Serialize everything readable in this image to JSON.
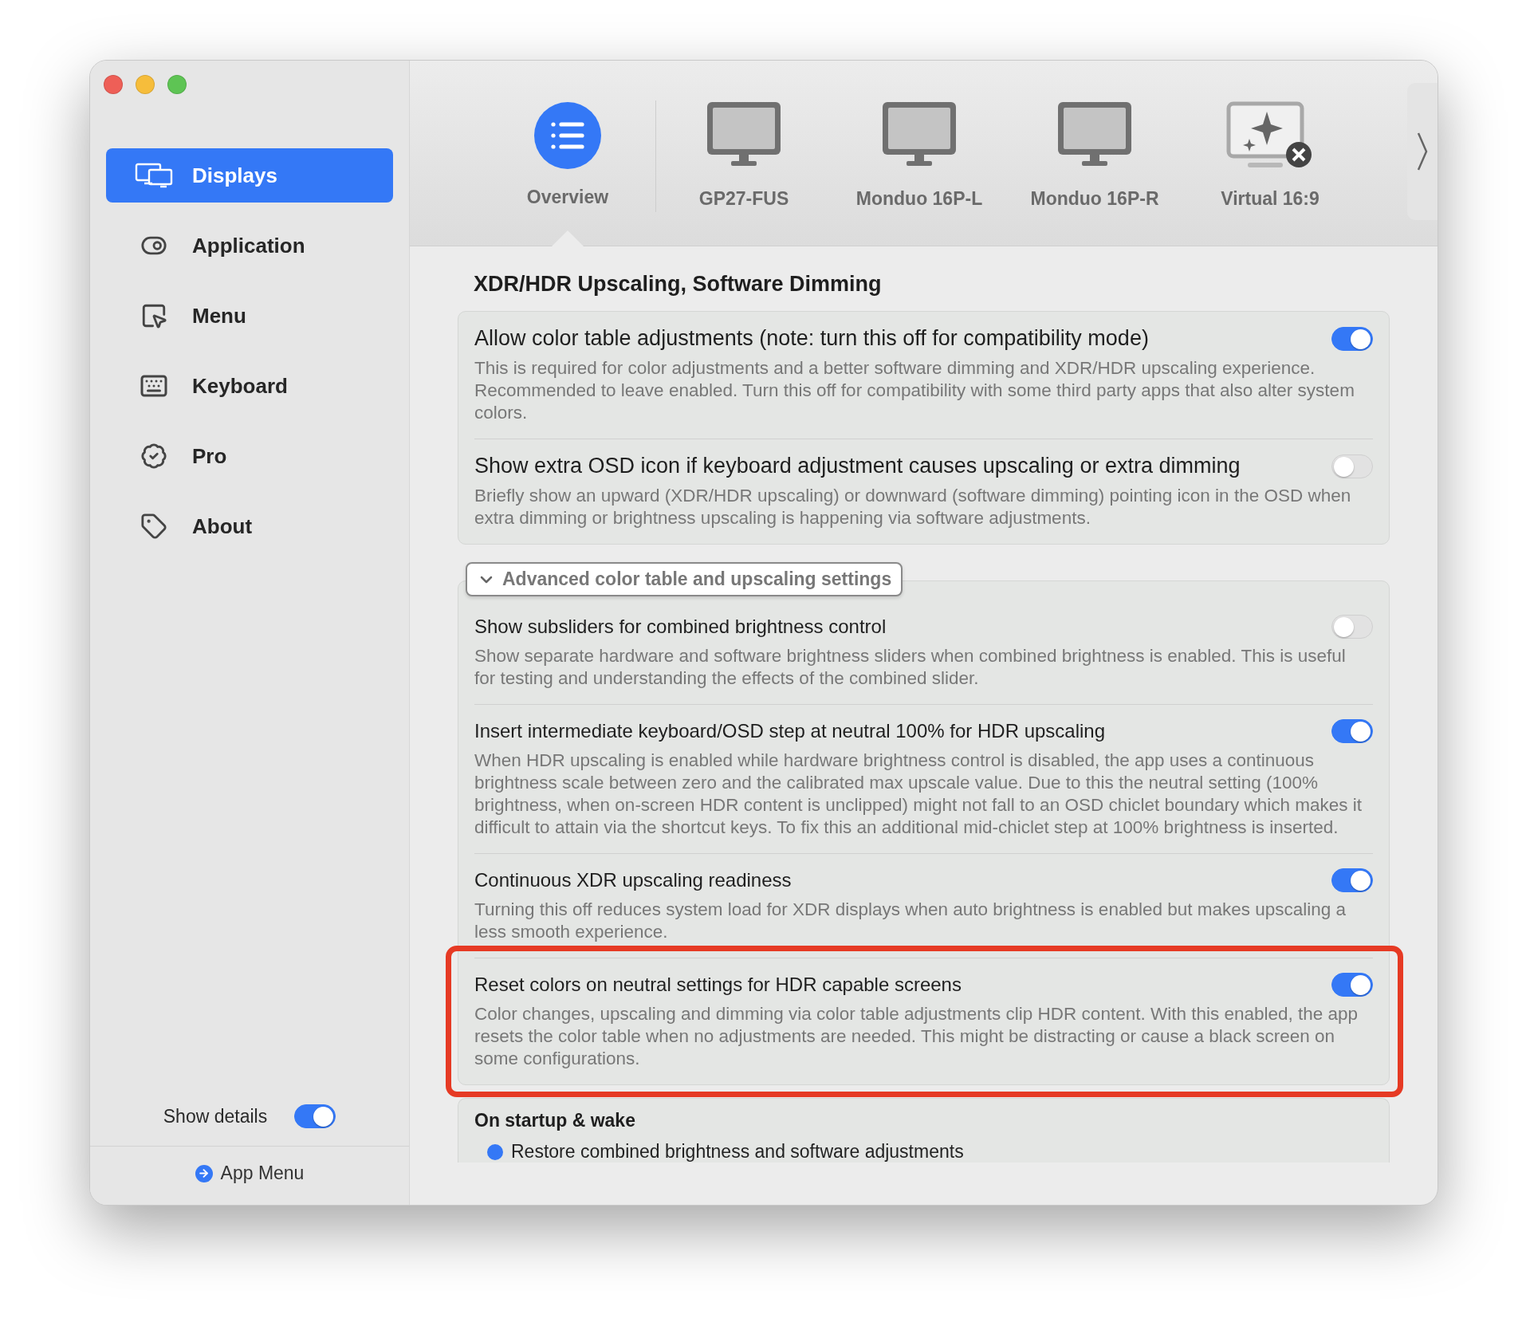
{
  "sidebar": {
    "items": [
      {
        "label": "Displays",
        "kind": "displays",
        "selected": true
      },
      {
        "label": "Application",
        "kind": "application",
        "selected": false
      },
      {
        "label": "Menu",
        "kind": "menu",
        "selected": false
      },
      {
        "label": "Keyboard",
        "kind": "keyboard",
        "selected": false
      },
      {
        "label": "Pro",
        "kind": "pro",
        "selected": false
      },
      {
        "label": "About",
        "kind": "about",
        "selected": false
      }
    ],
    "show_details": {
      "label": "Show details",
      "on": true
    },
    "footer_link": "App Menu"
  },
  "tabs": [
    {
      "label": "Overview",
      "kind": "overview",
      "selected": true
    },
    {
      "label": "GP27-FUS",
      "kind": "display",
      "selected": false
    },
    {
      "label": "Monduo 16P-L",
      "kind": "display",
      "selected": false
    },
    {
      "label": "Monduo 16P-R",
      "kind": "display",
      "selected": false
    },
    {
      "label": "Virtual 16:9",
      "kind": "virtual",
      "selected": false
    }
  ],
  "section": {
    "title": "XDR/HDR Upscaling, Software Dimming",
    "settings": [
      {
        "title": "Allow color table adjustments (note: turn this off for compatibility mode)",
        "description": "This is required for color adjustments and a better software dimming and XDR/HDR upscaling experience. Recommended to leave enabled. Turn this off for compatibility with some third party apps that also alter system colors.",
        "on": true
      },
      {
        "title": "Show extra OSD icon if keyboard adjustment causes upscaling or extra dimming",
        "description": "Briefly show an upward (XDR/HDR upscaling) or downward (software dimming) pointing icon in the OSD when extra dimming or brightness upscaling is happening via software adjustments.",
        "on": false
      }
    ]
  },
  "advanced": {
    "label": "Advanced color table and upscaling settings",
    "expanded": true,
    "settings": [
      {
        "title": "Show subsliders for combined brightness control",
        "description": "Show separate hardware and software brightness sliders when combined brightness is enabled. This is useful for testing and understanding the effects of the combined slider.",
        "on": false,
        "highlighted": false
      },
      {
        "title": "Insert intermediate keyboard/OSD step at neutral 100% for HDR upscaling",
        "description": "When HDR upscaling is enabled while hardware brightness control is disabled, the app uses a continuous brightness scale between zero and the calibrated max upscale value. Due to this the neutral setting (100% brightness, when on-screen HDR content is unclipped) might not fall to an OSD chiclet boundary which makes it difficult to attain via the shortcut keys. To fix this an additional mid-chiclet step at 100% brightness is inserted.",
        "on": true,
        "highlighted": false
      },
      {
        "title": "Continuous XDR upscaling readiness",
        "description": "Turning this off reduces system load for XDR displays when auto brightness is enabled but makes upscaling a less smooth experience.",
        "on": true,
        "highlighted": false
      },
      {
        "title": "Reset colors on neutral settings for HDR capable screens",
        "description": "Color changes, upscaling and dimming via color table adjustments clip HDR content. With this enabled, the app resets the color table when no adjustments are needed. This might be distracting or cause a black screen on some configurations.",
        "on": true,
        "highlighted": true
      }
    ]
  },
  "startup": {
    "title": "On startup & wake",
    "options": [
      {
        "label": "Restore combined brightness and software adjustments",
        "selected": true
      }
    ]
  }
}
